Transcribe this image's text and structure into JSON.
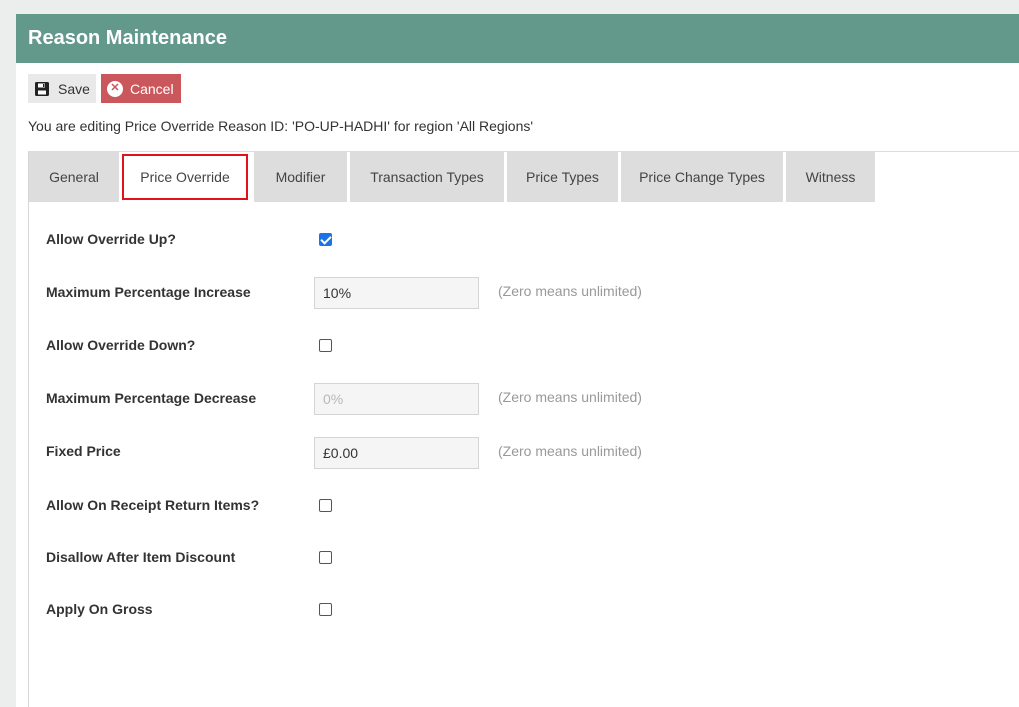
{
  "header": {
    "title": "Reason Maintenance"
  },
  "toolbar": {
    "save_label": "Save",
    "cancel_label": "Cancel",
    "save_icon": "floppy-disk",
    "cancel_icon": "x-circle"
  },
  "info_text": "You are editing Price Override Reason ID: 'PO-UP-HADHI' for region 'All Regions'",
  "tabs": [
    {
      "label": "General"
    },
    {
      "label": "Price Override",
      "active": true
    },
    {
      "label": "Modifier"
    },
    {
      "label": "Transaction Types"
    },
    {
      "label": "Price Types"
    },
    {
      "label": "Price Change Types"
    },
    {
      "label": "Witness"
    }
  ],
  "form": {
    "allow_override_up": {
      "label": "Allow Override Up?",
      "checked": true
    },
    "max_pct_increase": {
      "label": "Maximum Percentage Increase",
      "value": "10%",
      "hint": "(Zero means unlimited)"
    },
    "allow_override_down": {
      "label": "Allow Override Down?",
      "checked": false
    },
    "max_pct_decrease": {
      "label": "Maximum Percentage Decrease",
      "value": "0%",
      "hint": "(Zero means unlimited)",
      "disabled": true
    },
    "fixed_price": {
      "label": "Fixed Price",
      "value": "£0.00",
      "hint": "(Zero means unlimited)"
    },
    "allow_on_receipt_return": {
      "label": "Allow On Receipt Return Items?",
      "checked": false
    },
    "disallow_after_item_discount": {
      "label": "Disallow After Item Discount",
      "checked": false
    },
    "apply_on_gross": {
      "label": "Apply On Gross",
      "checked": false
    }
  },
  "colors": {
    "header": "#63998a",
    "cancel": "#c9575c",
    "active_tab_outline": "#e0121a",
    "checkbox_checked": "#1a73e8"
  }
}
